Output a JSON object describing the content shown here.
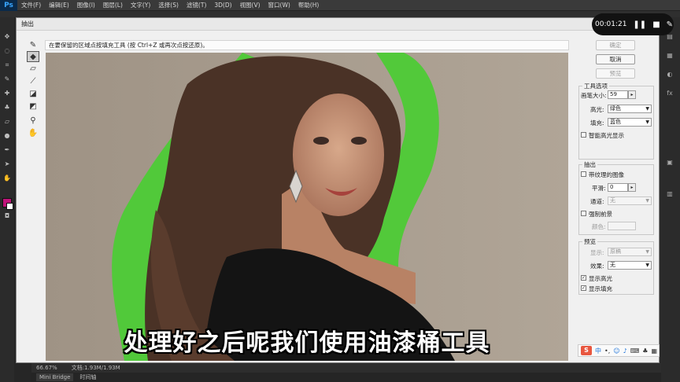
{
  "app": {
    "logo": "Ps",
    "menus": [
      "文件(F)",
      "编辑(E)",
      "图像(I)",
      "图层(L)",
      "文字(Y)",
      "选择(S)",
      "滤镜(T)",
      "3D(D)",
      "视图(V)",
      "窗口(W)",
      "帮助(H)"
    ]
  },
  "dialog": {
    "title": "抽出",
    "hint": "在要保留的区域点按填充工具 (按 Ctrl+Z 或再次点按还原)。",
    "buttons": {
      "ok": "确定",
      "cancel": "取消",
      "preview": "预览"
    },
    "tool_options": {
      "title": "工具选项",
      "brush_size_label": "画笔大小:",
      "brush_size": "59",
      "highlight_label": "高光:",
      "highlight_value": "绿色",
      "fill_label": "填充:",
      "fill_value": "蓝色",
      "smart_highlight_label": "智能高光显示"
    },
    "extraction": {
      "title": "抽出",
      "textured_label": "带纹理的图像",
      "smooth_label": "平滑:",
      "smooth_value": "0",
      "channel_label": "通道:",
      "channel_value": "无",
      "force_fg_label": "强制前景",
      "color_label": "颜色:"
    },
    "preview": {
      "title": "预览",
      "show_label": "显示:",
      "show_value": "原稿",
      "effect_label": "效果:",
      "effect_value": "无",
      "show_highlight_label": "显示高光",
      "show_fill_label": "显示填充"
    }
  },
  "recorder": {
    "time": "00:01:21"
  },
  "caption": "处理好之后呢我们使用油漆桶工具",
  "status": {
    "zoom": "66.67%",
    "doc": "文档:1.93M/1.93M"
  },
  "bottom_tabs": [
    "Mini Bridge",
    "时间轴"
  ],
  "colors": {
    "highlight_green": "#4dcb36",
    "foreground": "#c0137a",
    "dialog_bg": "#f0f0f0",
    "ps_dark": "#262626"
  }
}
